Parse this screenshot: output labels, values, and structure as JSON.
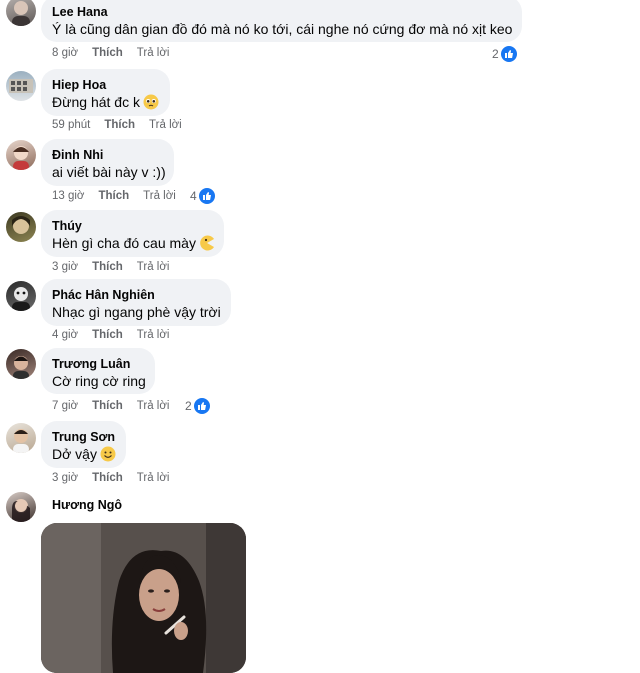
{
  "comments": [
    {
      "name": "Lee Hana",
      "text": "Ý là cũng dân gian đồ đó mà nó ko tới, cái nghe nó cứng đơ mà nó xịt keo",
      "time": "8 giờ",
      "like": "Thích",
      "reply": "Trả lời",
      "reactions": "2"
    },
    {
      "name": "Hiep Hoa",
      "text": "Đừng hát đc k",
      "time": "59 phút",
      "like": "Thích",
      "reply": "Trả lời",
      "emoji": "pleading-face-icon"
    },
    {
      "name": "Đinh Nhi",
      "text": "ai viết bài này v :))",
      "time": "13 giờ",
      "like": "Thích",
      "reply": "Trả lời",
      "reactions": "4"
    },
    {
      "name": "Thúy",
      "text": "Hèn gì cha đó cau mày",
      "time": "3 giờ",
      "like": "Thích",
      "reply": "Trả lời",
      "emoji": "pacman-face-icon"
    },
    {
      "name": "Phác Hân Nghiên",
      "text": "Nhạc gì ngang phè vậy trời",
      "time": "4 giờ",
      "like": "Thích",
      "reply": "Trả lời"
    },
    {
      "name": "Trương Luân",
      "text": "Cờ ring cờ ring",
      "time": "7 giờ",
      "like": "Thích",
      "reply": "Trả lời",
      "reactions": "2"
    },
    {
      "name": "Trung Sơn",
      "text": "Dở vậy",
      "time": "3 giờ",
      "like": "Thích",
      "reply": "Trả lời",
      "emoji": "smile-face-icon"
    },
    {
      "name": "Hương Ngô"
    }
  ],
  "colors": {
    "bubble": "#f0f2f5",
    "meta": "#65676b",
    "like_blue": "#1877f2"
  }
}
